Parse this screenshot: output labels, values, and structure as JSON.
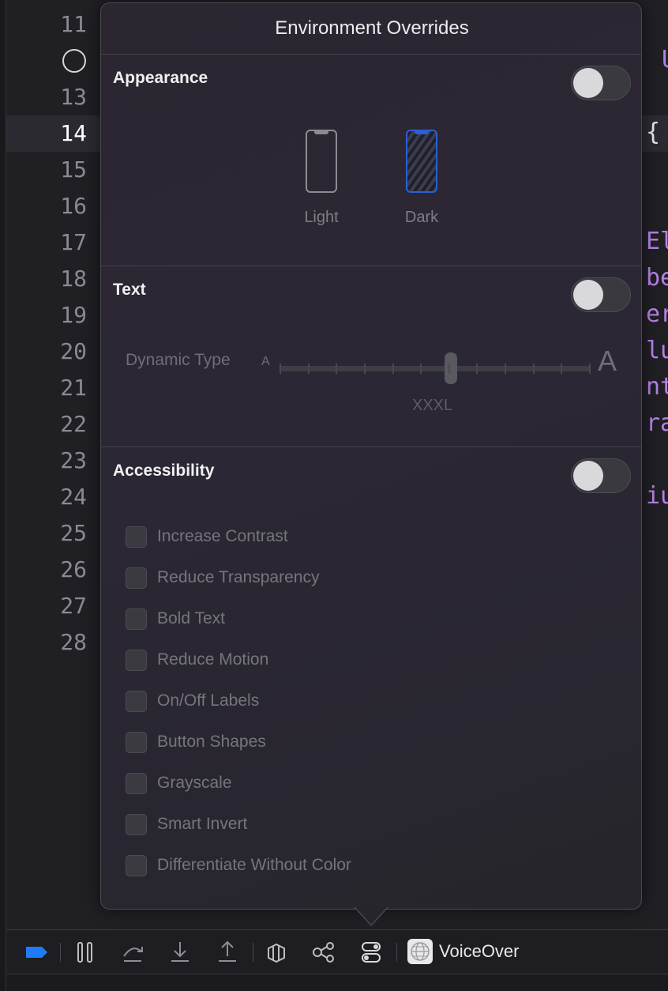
{
  "gutter": {
    "lines": [
      "11",
      "13",
      "14",
      "15",
      "16",
      "17",
      "18",
      "19",
      "20",
      "21",
      "22",
      "23",
      "24",
      "25",
      "26",
      "27",
      "28"
    ],
    "active_line": "14"
  },
  "code_fragments": [
    "U",
    "{",
    "El",
    "be",
    "er",
    "lu",
    "nt",
    "ra",
    "iu"
  ],
  "popover": {
    "title": "Environment Overrides",
    "appearance": {
      "title": "Appearance",
      "enabled": false,
      "options": [
        {
          "label": "Light",
          "selected": false
        },
        {
          "label": "Dark",
          "selected": true
        }
      ]
    },
    "text": {
      "title": "Text",
      "enabled": false,
      "dynamic_type_label": "Dynamic Type",
      "small_glyph": "A",
      "large_glyph": "A",
      "value": "XXXL",
      "level": 0.55
    },
    "accessibility": {
      "title": "Accessibility",
      "enabled": false,
      "options": [
        {
          "label": "Increase Contrast",
          "checked": false
        },
        {
          "label": "Reduce Transparency",
          "checked": false
        },
        {
          "label": "Bold Text",
          "checked": false
        },
        {
          "label": "Reduce Motion",
          "checked": false
        },
        {
          "label": "On/Off Labels",
          "checked": false
        },
        {
          "label": "Button Shapes",
          "checked": false
        },
        {
          "label": "Grayscale",
          "checked": false
        },
        {
          "label": "Smart Invert",
          "checked": false
        },
        {
          "label": "Differentiate Without Color",
          "checked": false
        }
      ]
    }
  },
  "toolbar": {
    "scheme_label": "VoiceOver",
    "icons": [
      "breakpoint-icon",
      "pause-icon",
      "step-over-icon",
      "step-into-icon",
      "step-out-icon",
      "view-hierarchy-icon",
      "memory-graph-icon",
      "environment-overrides-icon",
      "voiceover-icon"
    ]
  },
  "colors": {
    "accent": "#1f7cf6",
    "dark_appearance": "#2c5fd6",
    "code_keyword": "#b381e6"
  }
}
